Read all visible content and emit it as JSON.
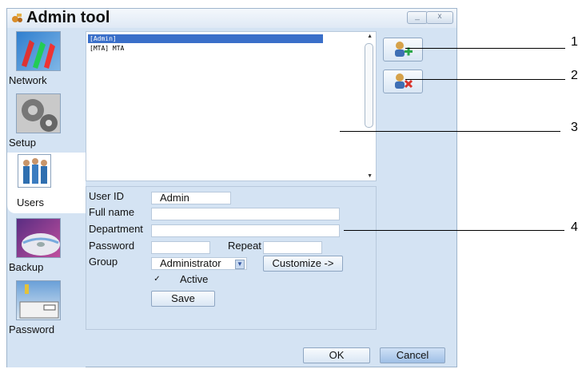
{
  "window": {
    "title": "Admin tool",
    "minimize_label": "_",
    "close_label": "x"
  },
  "sidebar": {
    "items": [
      {
        "label": "Network",
        "icon": "network-icon"
      },
      {
        "label": "Setup",
        "icon": "setup-gears-icon"
      },
      {
        "label": "Users",
        "icon": "users-icon",
        "selected": true
      },
      {
        "label": "Backup",
        "icon": "backup-cd-icon"
      },
      {
        "label": "Password",
        "icon": "password-key-icon"
      }
    ]
  },
  "user_list": {
    "items": [
      {
        "label": "[Admin]",
        "selected": true
      },
      {
        "label": "[MTA] MTA",
        "selected": false
      }
    ]
  },
  "form": {
    "user_id_label": "User ID",
    "user_id_value": "Admin",
    "full_name_label": "Full name",
    "full_name_value": "",
    "department_label": "Department",
    "department_value": "",
    "password_label": "Password",
    "password_value": "",
    "repeat_label": "Repeat",
    "repeat_value": "",
    "group_label": "Group",
    "group_value": "Administrator",
    "customize_label": "Customize ->",
    "active_label": "Active",
    "active_checked": true,
    "save_label": "Save"
  },
  "actions": {
    "ok_label": "OK",
    "cancel_label": "Cancel",
    "add_user_icon": "add-user-icon",
    "delete_user_icon": "delete-user-icon"
  },
  "callouts": [
    "1",
    "2",
    "3",
    "4"
  ]
}
